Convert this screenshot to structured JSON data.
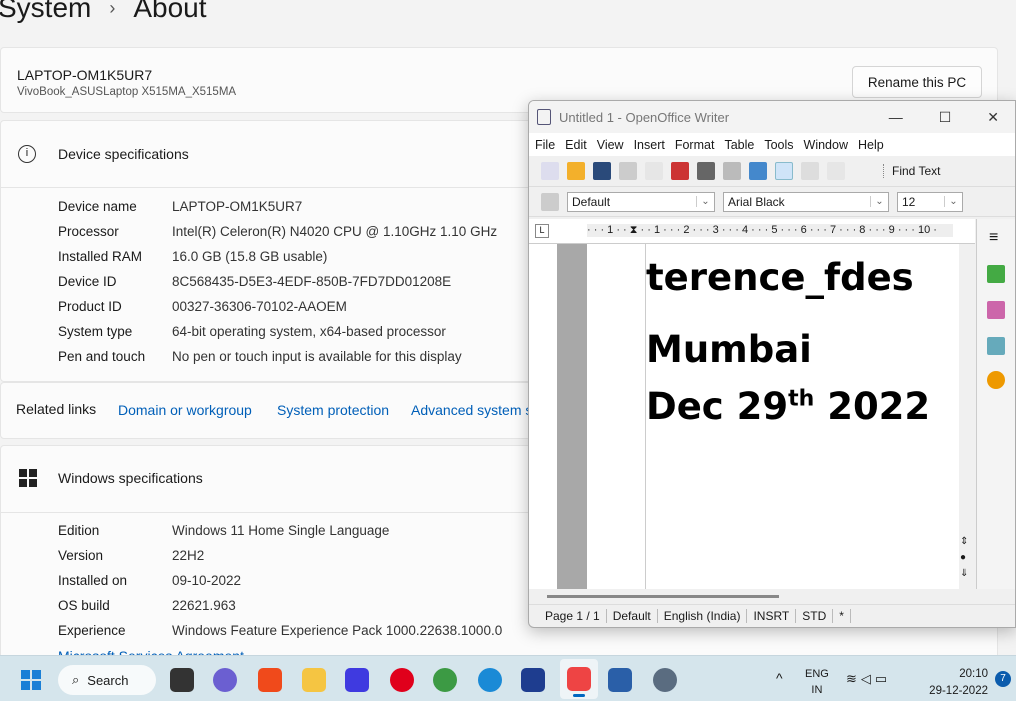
{
  "breadcrumb": {
    "parent": "System",
    "sep": "›",
    "current": "About"
  },
  "device": {
    "name": "LAPTOP-OM1K5UR7",
    "model": "VivoBook_ASUSLaptop X515MA_X515MA",
    "rename": "Rename this PC"
  },
  "device_specs": {
    "title": "Device specifications",
    "rows": [
      {
        "k": "Device name",
        "v": "LAPTOP-OM1K5UR7"
      },
      {
        "k": "Processor",
        "v": "Intel(R) Celeron(R) N4020 CPU @ 1.10GHz   1.10 GHz"
      },
      {
        "k": "Installed RAM",
        "v": "16.0 GB (15.8 GB usable)"
      },
      {
        "k": "Device ID",
        "v": "8C568435-D5E3-4EDF-850B-7FD7DD01208E"
      },
      {
        "k": "Product ID",
        "v": "00327-36306-70102-AAOEM"
      },
      {
        "k": "System type",
        "v": "64-bit operating system, x64-based processor"
      },
      {
        "k": "Pen and touch",
        "v": "No pen or touch input is available for this display"
      }
    ]
  },
  "related": {
    "label": "Related links",
    "links": [
      "Domain or workgroup",
      "System protection",
      "Advanced system s"
    ]
  },
  "win_specs": {
    "title": "Windows specifications",
    "rows": [
      {
        "k": "Edition",
        "v": "Windows 11 Home Single Language"
      },
      {
        "k": "Version",
        "v": "22H2"
      },
      {
        "k": "Installed on",
        "v": "09-10-2022"
      },
      {
        "k": "OS build",
        "v": "22621.963"
      },
      {
        "k": "Experience",
        "v": "Windows Feature Experience Pack 1000.22638.1000.0"
      }
    ],
    "agreement": "Microsoft Services Agreement"
  },
  "writer": {
    "title": "Untitled 1 - OpenOffice Writer",
    "menu": [
      "File",
      "Edit",
      "View",
      "Insert",
      "Format",
      "Table",
      "Tools",
      "Window",
      "Help"
    ],
    "find_text": "Find Text",
    "style": "Default",
    "font": "Arial Black",
    "size": "12",
    "ruler": "· · · 1 · · ⧗ · · 1 · · · 2 · · · 3 · · · 4 · · · 5 · · · 6 · · · 7 · · · 8 · · · 9 · · · 10 ·",
    "doc": {
      "line1": "terence_fdes",
      "line2": "Mumbai",
      "line3a": "Dec 29",
      "sup": "th",
      "line3b": " 2022"
    },
    "status": [
      "Page 1 / 1",
      "Default",
      "English (India)",
      "INSRT",
      "STD",
      "*"
    ]
  },
  "taskbar": {
    "search": "Search",
    "lang1": "ENG",
    "lang2": "IN",
    "time": "20:10",
    "date": "29-12-2022",
    "badge": "7"
  }
}
